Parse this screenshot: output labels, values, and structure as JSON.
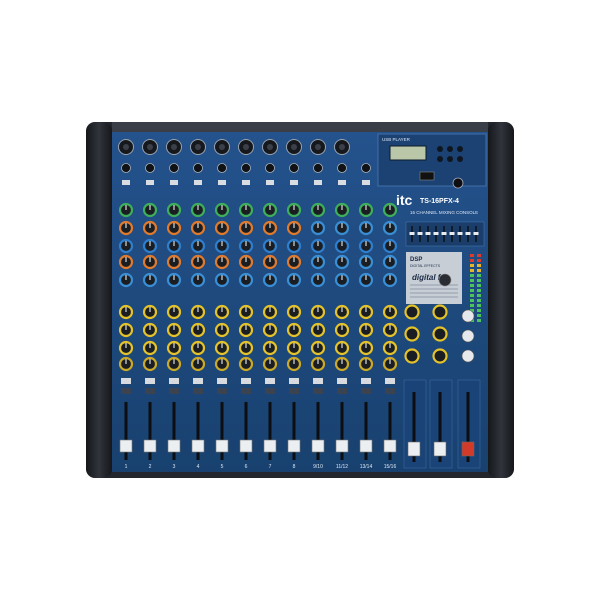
{
  "brand": {
    "logo": "itc",
    "model": "TS-16PFX-4",
    "subtitle": "16 CHANNEL MIXING CONSOLE"
  },
  "usb_player": {
    "title": "USB PLAYER"
  },
  "dsp": {
    "title": "DSP",
    "subtitle": "DIGITAL EFFECTS",
    "logo": "digital fx"
  },
  "channels": {
    "mono_labels": [
      "1",
      "2",
      "3",
      "4",
      "5",
      "6",
      "7",
      "8"
    ],
    "stereo_labels": [
      "9/10",
      "11/12",
      "13/14",
      "15/16"
    ]
  },
  "colors": {
    "chassis": "#262a32",
    "panel": "#1f4d86",
    "panel_dark": "#173a66",
    "knob_green": "#3fae5a",
    "knob_orange": "#e07a2c",
    "knob_blue": "#3a8fd4",
    "knob_yellow": "#e4c22a",
    "fader_red": "#d23a2a"
  }
}
